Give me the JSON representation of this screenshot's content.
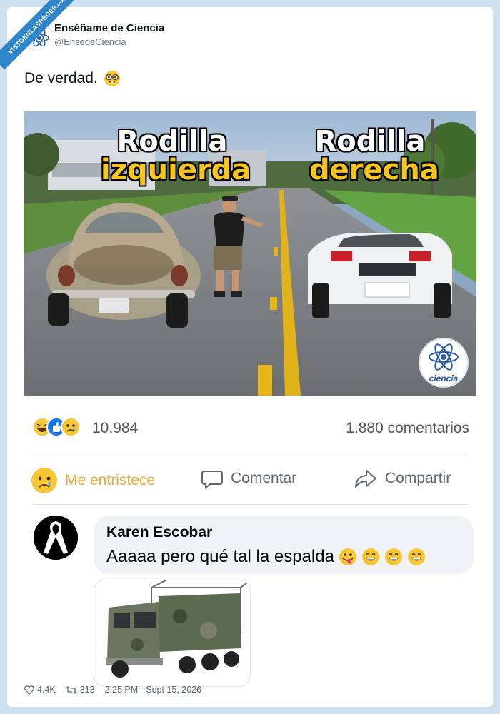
{
  "watermark": {
    "text": "VISTOENLASREDES",
    "suffix": ".com"
  },
  "tweet": {
    "author_name": "Enséñame de Ciencia",
    "author_handle": "@EnsedeCiencia",
    "text": "De verdad.",
    "emoji_icon": "nerd-face-emoji"
  },
  "meme": {
    "left_label_line1": "Rodilla",
    "left_label_line2": "izquierda",
    "right_label_line1": "Rodilla",
    "right_label_line2": "derecha",
    "logo_text": "ciencia",
    "colors": {
      "white_text": "#ffffff",
      "yellow_text": "#f8c61b"
    }
  },
  "facebook": {
    "reaction_icons": [
      "laugh-icon",
      "like-icon",
      "sad-icon"
    ],
    "reaction_count": "10.984",
    "comments_count": "1.880 comentarios",
    "actions": {
      "react_label": "Me entristece",
      "comment_label": "Comentar",
      "share_label": "Compartir"
    },
    "comment": {
      "author": "Karen Escobar",
      "text": "Aaaaa pero qué tal la espalda",
      "emojis": [
        "tongue-face-emoji",
        "grin-emoji",
        "grin-emoji",
        "grin-emoji"
      ]
    }
  },
  "footer": {
    "likes": "4.4K",
    "retweets": "313",
    "timestamp": "2:25 PM - Sept 15, 2026"
  }
}
